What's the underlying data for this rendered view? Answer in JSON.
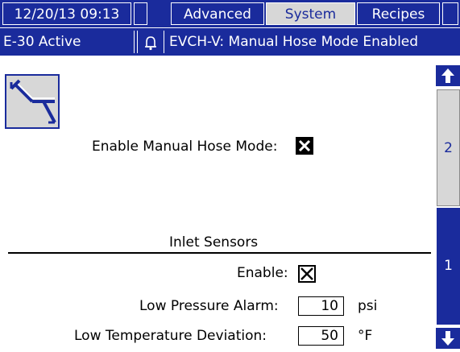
{
  "status_bar": {
    "datetime": "12/20/13 09:13",
    "tabs": [
      {
        "label": "Advanced"
      },
      {
        "label": "System",
        "selected": true
      },
      {
        "label": "Recipes"
      }
    ]
  },
  "alarm_bar": {
    "active_error": "E-30 Active",
    "event_message": "EVCH-V: Manual Hose Mode Enabled",
    "icons": [
      "bell-icon"
    ]
  },
  "screen": {
    "mode_icon": "setup-mode-icon",
    "manual_hose_mode": {
      "label": "Enable Manual Hose Mode:",
      "checked": true
    },
    "inlet_sensors": {
      "heading": "Inlet Sensors",
      "enable": {
        "label": "Enable:",
        "checked": true
      },
      "low_pressure_alarm": {
        "label": "Low Pressure Alarm:",
        "value": "10",
        "unit": "psi"
      },
      "low_temperature_deviation": {
        "label": "Low Temperature Deviation:",
        "value": "50",
        "unit": "°F"
      }
    }
  },
  "pager": {
    "pages": [
      "2",
      "1"
    ],
    "current_page": "1",
    "up_icon": "arrow-up-icon",
    "down_icon": "arrow-down-icon"
  },
  "colors": {
    "bar": "#1a2b9c",
    "selected_tab": "#d7d7d7",
    "background": "#ffffff"
  }
}
